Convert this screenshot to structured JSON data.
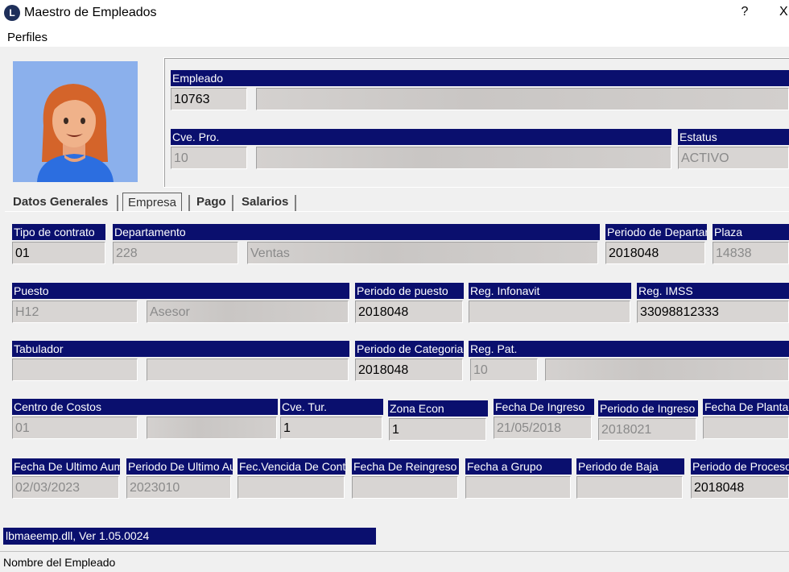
{
  "window": {
    "title": "Maestro de Empleados",
    "app_icon_glyph": "L",
    "help": "?",
    "close": "X"
  },
  "menu": {
    "perfiles": "Perfiles"
  },
  "header": {
    "empleado_label": "Empleado",
    "empleado_value": "10763",
    "cvepro_label": "Cve. Pro.",
    "cvepro_value": "10",
    "estatus_label": "Estatus",
    "estatus_value": "ACTIVO"
  },
  "tabs": [
    "Datos Generales",
    "Empresa",
    "Pago",
    "Salarios"
  ],
  "form": {
    "tipo_contrato_label": "Tipo de contrato",
    "tipo_contrato_value": "01",
    "departamento_label": "Departamento",
    "departamento_code": "228",
    "departamento_name": "Ventas",
    "periodo_depto_label": "Periodo de Departamento",
    "periodo_depto_value": "2018048",
    "plaza_label": "Plaza",
    "plaza_value": "14838",
    "puesto_label": "Puesto",
    "puesto_code": "H12",
    "puesto_name": "Asesor",
    "periodo_puesto_label": "Periodo de puesto",
    "periodo_puesto_value": "2018048",
    "infonavit_label": "Reg. Infonavit",
    "infonavit_value": "",
    "imss_label": "Reg. IMSS",
    "imss_value": "33098812333",
    "tabulador_label": "Tabulador",
    "tabulador_code": "",
    "tabulador_name": "",
    "periodo_categoria_label": "Periodo de Categoria",
    "periodo_categoria_value": "2018048",
    "regpat_label": "Reg. Pat.",
    "regpat_value": "10",
    "centro_costos_label": "Centro de Costos",
    "centro_costos_value": "01",
    "cvetur_label": "Cve. Tur.",
    "cvetur_value": "1",
    "zona_econ_label": "Zona Econ",
    "zona_econ_value": "1",
    "fecha_ingreso_label": "Fecha De Ingreso",
    "fecha_ingreso_value": "21/05/2018",
    "periodo_ingreso_label": "Periodo de Ingreso",
    "periodo_ingreso_value": "2018021",
    "fecha_planta_label": "Fecha De Planta",
    "fecha_planta_value": "",
    "fecha_ult_aum_label": "Fecha De Ultimo Aumento",
    "fecha_ult_aum_value": "02/03/2023",
    "periodo_ult_aum_label": "Periodo De Ultimo Aumento",
    "periodo_ult_aum_value": "2023010",
    "fec_vencida_label": "Fec.Vencida De Contrato",
    "fec_vencida_value": "",
    "fecha_reingreso_label": "Fecha De Reingreso",
    "fecha_reingreso_value": "",
    "fecha_grupo_label": "Fecha a Grupo",
    "fecha_grupo_value": "",
    "periodo_baja_label": "Periodo de Baja",
    "periodo_baja_value": "",
    "periodo_proceso_label": "Periodo de Proceso",
    "periodo_proceso_value": "2018048"
  },
  "status": {
    "version": "lbmaeemp.dll, Ver 1.05.0024",
    "hint": "Nombre del Empleado"
  },
  "colors": {
    "label_bg": "#0a0f6e",
    "field_bg": "#d8d5d3",
    "window_bg": "#f0f0f0",
    "photo_bg": "#8bb0ec"
  }
}
